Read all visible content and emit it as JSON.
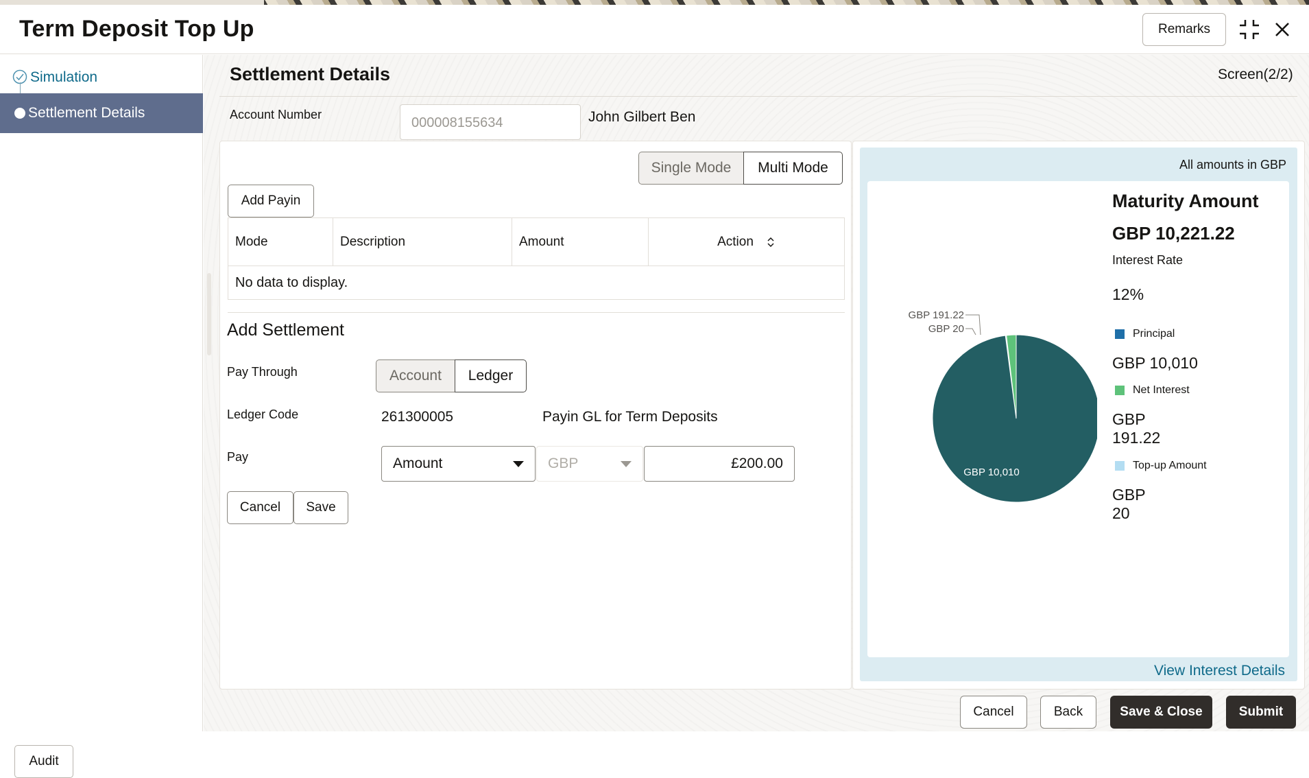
{
  "header": {
    "title": "Term Deposit Top Up",
    "remarks_label": "Remarks"
  },
  "sidebar": {
    "steps": [
      {
        "label": "Simulation",
        "state": "completed"
      },
      {
        "label": "Settlement Details",
        "state": "active"
      }
    ],
    "audit_label": "Audit"
  },
  "main": {
    "section_title": "Settlement Details",
    "screen_indicator": "Screen(2/2)",
    "account_number_label": "Account Number",
    "account_number_value": "000008155634",
    "account_holder": "John Gilbert Ben",
    "mode_toggle": {
      "single": "Single Mode",
      "multi": "Multi Mode",
      "selected": "Multi Mode"
    },
    "add_payin_label": "Add Payin",
    "table": {
      "columns": [
        "Mode",
        "Description",
        "Amount",
        "Action"
      ],
      "empty_message": "No data to display."
    },
    "add_settlement": {
      "title": "Add Settlement",
      "pay_through_label": "Pay Through",
      "pay_through_options": [
        "Account",
        "Ledger"
      ],
      "pay_through_selected": "Ledger",
      "ledger_code_label": "Ledger Code",
      "ledger_code_value": "261300005",
      "ledger_code_description": "Payin GL for Term Deposits",
      "pay_label": "Pay",
      "pay_type_value": "Amount",
      "currency_value": "GBP",
      "amount_value": "£200.00",
      "cancel_label": "Cancel",
      "save_label": "Save"
    }
  },
  "summary": {
    "unit_note": "All amounts in GBP",
    "maturity_amount_label": "Maturity Amount",
    "maturity_amount_value": "GBP 10,221.22",
    "interest_rate_label": "Interest Rate",
    "interest_rate_value": "12%",
    "legend": [
      {
        "label": "Principal",
        "value": "GBP 10,010",
        "color": "#1f6fa8"
      },
      {
        "label": "Net Interest",
        "value": "GBP 191.22",
        "color": "#5ec27a"
      },
      {
        "label": "Top-up Amount",
        "value": "GBP 20",
        "color": "#b3ddf2"
      }
    ],
    "view_link_label": "View Interest Details"
  },
  "chart_data": {
    "type": "pie",
    "slices": [
      {
        "label": "GBP 10,010",
        "value": 10010,
        "color": "#235e63"
      },
      {
        "label": "GBP 191.22",
        "value": 191.22,
        "color": "#5ec27a"
      },
      {
        "label": "GBP 20",
        "value": 20,
        "color": "#b3ddf2"
      }
    ]
  },
  "footer": {
    "cancel_label": "Cancel",
    "back_label": "Back",
    "save_close_label": "Save & Close",
    "submit_label": "Submit"
  }
}
